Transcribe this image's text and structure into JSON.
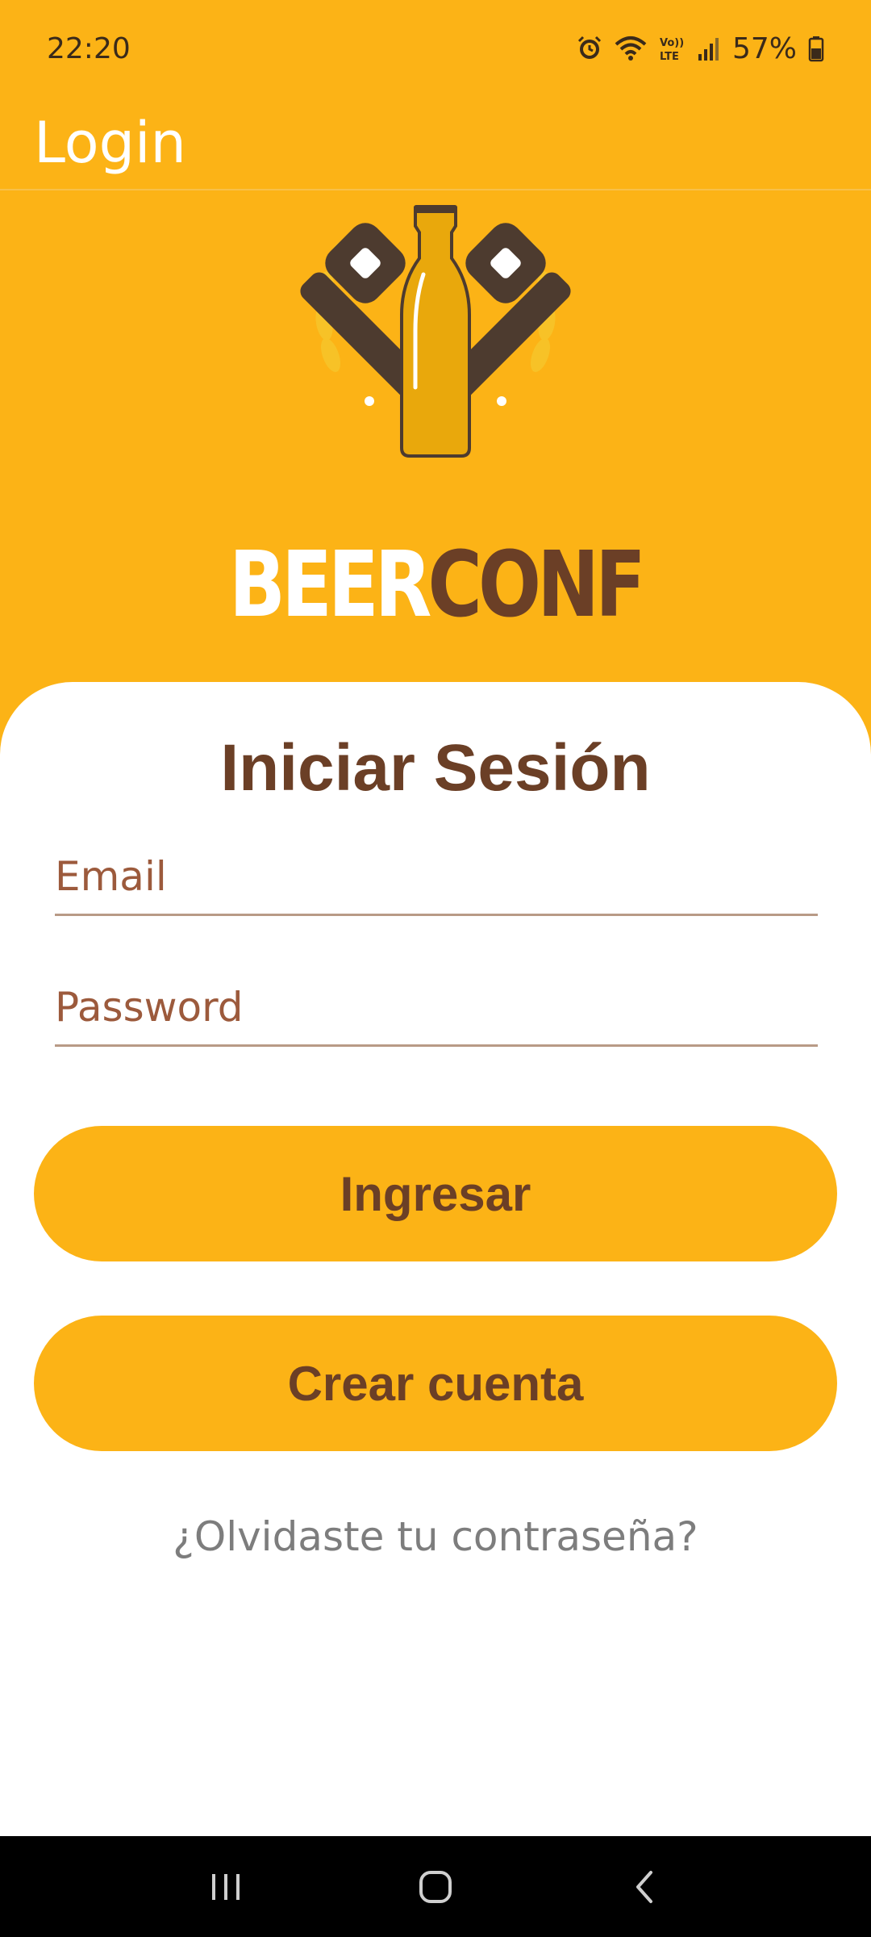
{
  "status_bar": {
    "time": "22:20",
    "battery": "57%",
    "icons": [
      "alarm-icon",
      "wifi-icon",
      "volte-icon",
      "signal-icon",
      "battery-icon"
    ]
  },
  "app_bar": {
    "title": "Login"
  },
  "brand": {
    "part1": "BEER",
    "part2": "CONF"
  },
  "login_card": {
    "title": "Iniciar Sesión",
    "email_placeholder": "Email",
    "email_value": "",
    "password_placeholder": "Password",
    "password_value": "",
    "login_button": "Ingresar",
    "create_account_button": "Crear cuenta",
    "forgot_password_link": "¿Olvidaste tu contraseña?"
  },
  "nav_bar": {
    "buttons": [
      "recents-icon",
      "home-icon",
      "back-icon"
    ]
  },
  "colors": {
    "primary": "#FCB316",
    "brown": "#6B3F26",
    "white": "#FFFFFF",
    "muted_text": "#7D7D7D"
  }
}
